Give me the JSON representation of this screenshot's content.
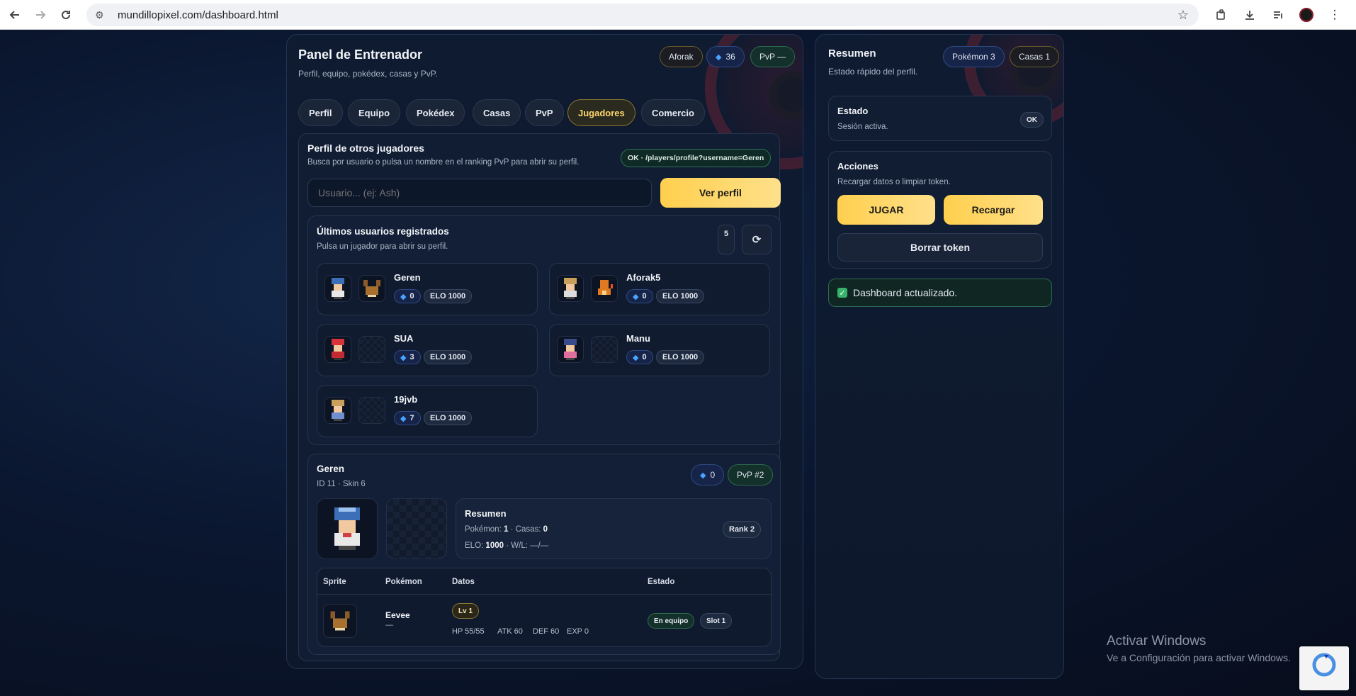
{
  "browser": {
    "url": "mundillopixel.com/dashboard.html",
    "icons": [
      "back-icon",
      "forward-icon",
      "reload-icon",
      "site-settings-icon",
      "star-icon",
      "extensions-icon",
      "download-icon",
      "media-icon",
      "profile-icon",
      "menu-icon"
    ]
  },
  "main": {
    "title": "Panel de Entrenador",
    "subtitle": "Perfil, equipo, pokédex, casas y PvP.",
    "badges": {
      "user": "Aforak",
      "gems": "36",
      "pvp": "PvP —"
    },
    "tabs": [
      {
        "label": "Perfil",
        "active": false
      },
      {
        "label": "Equipo",
        "active": false
      },
      {
        "label": "Pokédex",
        "active": false
      },
      {
        "label": "Casas",
        "active": false
      },
      {
        "label": "PvP",
        "active": false
      },
      {
        "label": "Jugadores",
        "active": true
      },
      {
        "label": "Comercio",
        "active": false
      }
    ],
    "players": {
      "title": "Perfil de otros jugadores",
      "subtitle": "Busca por usuario o pulsa un nombre en el ranking PvP para abrir su perfil.",
      "endpoint": "OK · /players/profile?username=Geren",
      "search_placeholder": "Usuario... (ej: Ash)",
      "search_button": "Ver perfil"
    },
    "recent": {
      "title": "Últimos usuarios registrados",
      "subtitle": "Pulsa un jugador para abrir su perfil.",
      "count": "5",
      "refresh_icon": "refresh-icon",
      "users": [
        {
          "name": "Geren",
          "gems": "0",
          "elo": "ELO 1000",
          "has_pokemon": true
        },
        {
          "name": "Aforak5",
          "gems": "0",
          "elo": "ELO 1000",
          "has_pokemon": true
        },
        {
          "name": "SUA",
          "gems": "3",
          "elo": "ELO 1000",
          "has_pokemon": false
        },
        {
          "name": "Manu",
          "gems": "0",
          "elo": "ELO 1000",
          "has_pokemon": false
        },
        {
          "name": "19jvb",
          "gems": "7",
          "elo": "ELO 1000",
          "has_pokemon": false
        }
      ]
    },
    "profile": {
      "name": "Geren",
      "meta": "ID 11 · Skin 6",
      "gems": "0",
      "pvp": "PvP #2",
      "summary": {
        "title": "Resumen",
        "pokemon_label": "Pokémon:",
        "pokemon_value": "1",
        "houses_label": "Casas:",
        "houses_value": "0",
        "elo_label": "ELO:",
        "elo_value": "1000",
        "wl_label": "W/L:",
        "wl_value": "—/—",
        "rank": "Rank 2"
      },
      "table": {
        "headers": [
          "Sprite",
          "Pokémon",
          "Datos",
          "Estado"
        ],
        "rows": [
          {
            "pokemon": "Eevee",
            "nickname": "—",
            "level": "Lv 1",
            "hp": "HP 55/55",
            "atk": "ATK 60",
            "def": "DEF 60",
            "exp": "EXP 0",
            "status": "En equipo",
            "slot": "Slot 1"
          }
        ]
      }
    }
  },
  "side": {
    "title": "Resumen",
    "subtitle": "Estado rápido del perfil.",
    "badges": {
      "pokemon": "Pokémon 3",
      "houses": "Casas 1"
    },
    "status": {
      "title": "Estado",
      "text": "Sesión activa.",
      "badge": "OK"
    },
    "actions": {
      "title": "Acciones",
      "text": "Recargar datos o limpiar token.",
      "play": "JUGAR",
      "reload": "Recargar",
      "clear": "Borrar token"
    },
    "toast": "Dashboard actualizado."
  },
  "os": {
    "watermark_title": "Activar Windows",
    "watermark_text": "Ve a Configuración para activar Windows."
  },
  "colors": {
    "accent_gold": "#ffcf4d",
    "gem_blue": "#4aa3ff",
    "ok_green": "#2d6a4e",
    "background": "#0b1730"
  }
}
